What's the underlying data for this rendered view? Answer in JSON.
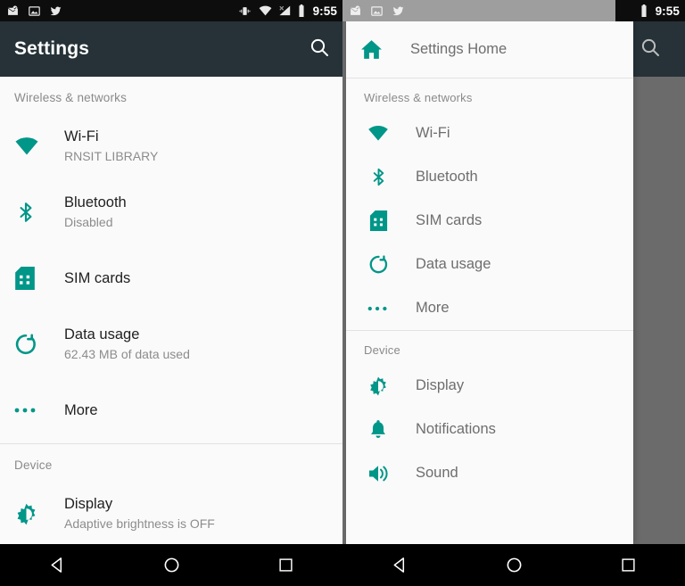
{
  "status_bar": {
    "time": "9:55",
    "left_icons": [
      "email-icon",
      "image-icon",
      "twitter-icon"
    ],
    "right_icons": [
      "vibrate-icon",
      "wifi-icon",
      "signal-off-icon",
      "battery-icon"
    ]
  },
  "colors": {
    "toolbar_bg": "#263238",
    "accent_teal": "#009688",
    "list_bg": "#fafafa",
    "primary_text": "#212121",
    "secondary_text": "#8c8c8c",
    "scrim": "#6b6b6b",
    "navbar_bg": "#000000"
  },
  "left_screen": {
    "toolbar": {
      "title": "Settings",
      "search_icon": "search-icon"
    },
    "sections": [
      {
        "header": "Wireless & networks",
        "items": [
          {
            "icon": "wifi-icon",
            "title": "Wi-Fi",
            "subtitle": "RNSIT LIBRARY"
          },
          {
            "icon": "bluetooth-icon",
            "title": "Bluetooth",
            "subtitle": "Disabled"
          },
          {
            "icon": "sim-card-icon",
            "title": "SIM cards",
            "subtitle": ""
          },
          {
            "icon": "data-usage-icon",
            "title": "Data usage",
            "subtitle": "62.43 MB of data used"
          },
          {
            "icon": "more-dots-icon",
            "title": "More",
            "subtitle": ""
          }
        ]
      },
      {
        "header": "Device",
        "items": [
          {
            "icon": "brightness-icon",
            "title": "Display",
            "subtitle": "Adaptive brightness is OFF"
          }
        ]
      }
    ]
  },
  "right_screen": {
    "toolbar": {
      "search_icon": "search-icon"
    },
    "drawer": {
      "home": {
        "icon": "home-icon",
        "label": "Settings Home"
      },
      "sections": [
        {
          "header": "Wireless & networks",
          "items": [
            {
              "icon": "wifi-icon",
              "label": "Wi-Fi"
            },
            {
              "icon": "bluetooth-icon",
              "label": "Bluetooth"
            },
            {
              "icon": "sim-card-icon",
              "label": "SIM cards"
            },
            {
              "icon": "data-usage-icon",
              "label": "Data usage"
            },
            {
              "icon": "more-dots-icon",
              "label": "More"
            }
          ]
        },
        {
          "header": "Device",
          "items": [
            {
              "icon": "brightness-icon",
              "label": "Display"
            },
            {
              "icon": "notifications-icon",
              "label": "Notifications"
            },
            {
              "icon": "sound-icon",
              "label": "Sound"
            }
          ]
        }
      ]
    }
  },
  "nav_bar": {
    "buttons": [
      "back-button",
      "home-button",
      "recents-button"
    ]
  }
}
